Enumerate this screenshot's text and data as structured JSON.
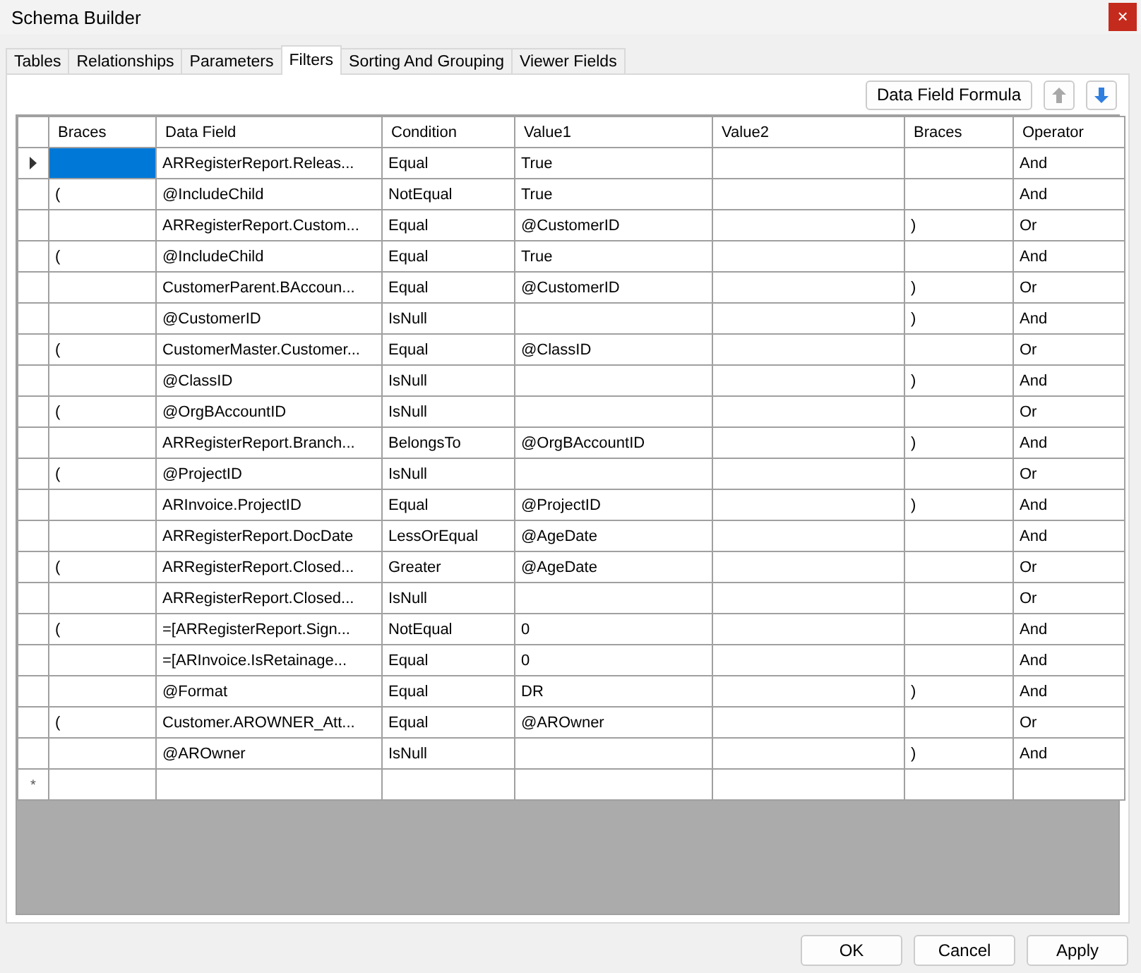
{
  "window": {
    "title": "Schema Builder",
    "close": "×"
  },
  "tabs": [
    {
      "label": "Tables",
      "selected": false
    },
    {
      "label": "Relationships",
      "selected": false
    },
    {
      "label": "Parameters",
      "selected": false
    },
    {
      "label": "Filters",
      "selected": true
    },
    {
      "label": "Sorting And Grouping",
      "selected": false
    },
    {
      "label": "Viewer Fields",
      "selected": false
    }
  ],
  "toolbar": {
    "formula_button": "Data Field Formula",
    "move_up": {
      "disabled": true
    },
    "move_down": {
      "disabled": false
    }
  },
  "table": {
    "columns": [
      "Braces",
      "Data Field",
      "Condition",
      "Value1",
      "Value2",
      "Braces",
      "Operator"
    ],
    "rows": [
      {
        "selected": true,
        "data_field": "ARRegisterReport.Releas...",
        "condition": "Equal",
        "value1": "True",
        "operator": "And"
      },
      {
        "selected": false,
        "open_brace": "(",
        "data_field": "@IncludeChild",
        "condition": "NotEqual",
        "value1": "True",
        "operator": "And"
      },
      {
        "selected": false,
        "data_field": "ARRegisterReport.Custom...",
        "condition": "Equal",
        "value1": "@CustomerID",
        "close_brace": ")",
        "operator": "Or"
      },
      {
        "selected": false,
        "open_brace": "(",
        "data_field": "@IncludeChild",
        "condition": "Equal",
        "value1": "True",
        "operator": "And"
      },
      {
        "selected": false,
        "data_field": "CustomerParent.BAccoun...",
        "condition": "Equal",
        "value1": "@CustomerID",
        "close_brace": ")",
        "operator": "Or"
      },
      {
        "selected": false,
        "data_field": "@CustomerID",
        "condition": "IsNull",
        "close_brace": ")",
        "operator": "And"
      },
      {
        "selected": false,
        "open_brace": "(",
        "data_field": "CustomerMaster.Customer...",
        "condition": "Equal",
        "value1": "@ClassID",
        "operator": "Or"
      },
      {
        "selected": false,
        "data_field": "@ClassID",
        "condition": "IsNull",
        "close_brace": ")",
        "operator": "And"
      },
      {
        "selected": false,
        "open_brace": "(",
        "data_field": "@OrgBAccountID",
        "condition": "IsNull",
        "operator": "Or"
      },
      {
        "selected": false,
        "data_field": "ARRegisterReport.Branch...",
        "condition": "BelongsTo",
        "value1": "@OrgBAccountID",
        "close_brace": ")",
        "operator": "And"
      },
      {
        "selected": false,
        "open_brace": "(",
        "data_field": "@ProjectID",
        "condition": "IsNull",
        "operator": "Or"
      },
      {
        "selected": false,
        "data_field": "ARInvoice.ProjectID",
        "condition": "Equal",
        "value1": "@ProjectID",
        "close_brace": ")",
        "operator": "And"
      },
      {
        "selected": false,
        "data_field": "ARRegisterReport.DocDate",
        "condition": "LessOrEqual",
        "value1": "@AgeDate",
        "operator": "And"
      },
      {
        "selected": false,
        "open_brace": "(",
        "data_field": "ARRegisterReport.Closed...",
        "condition": "Greater",
        "value1": "@AgeDate",
        "operator": "Or"
      },
      {
        "selected": false,
        "data_field": "ARRegisterReport.Closed...",
        "condition": "IsNull",
        "operator": "Or"
      },
      {
        "selected": false,
        "open_brace": "(",
        "data_field": "=[ARRegisterReport.Sign...",
        "condition": "NotEqual",
        "value1": "0",
        "operator": "And"
      },
      {
        "selected": false,
        "data_field": "=[ARInvoice.IsRetainage...",
        "condition": "Equal",
        "value1": "0",
        "operator": "And"
      },
      {
        "selected": false,
        "data_field": "@Format",
        "condition": "Equal",
        "value1": "DR",
        "close_brace": ")",
        "operator": "And"
      },
      {
        "selected": false,
        "open_brace": "(",
        "data_field": "Customer.AROWNER_Att...",
        "condition": "Equal",
        "value1": "@AROwner",
        "operator": "Or"
      },
      {
        "selected": false,
        "data_field": "@AROwner",
        "condition": "IsNull",
        "close_brace": ")",
        "operator": "And"
      }
    ],
    "new_row_marker": "*"
  },
  "buttons": [
    "OK",
    "Cancel",
    "Apply"
  ]
}
